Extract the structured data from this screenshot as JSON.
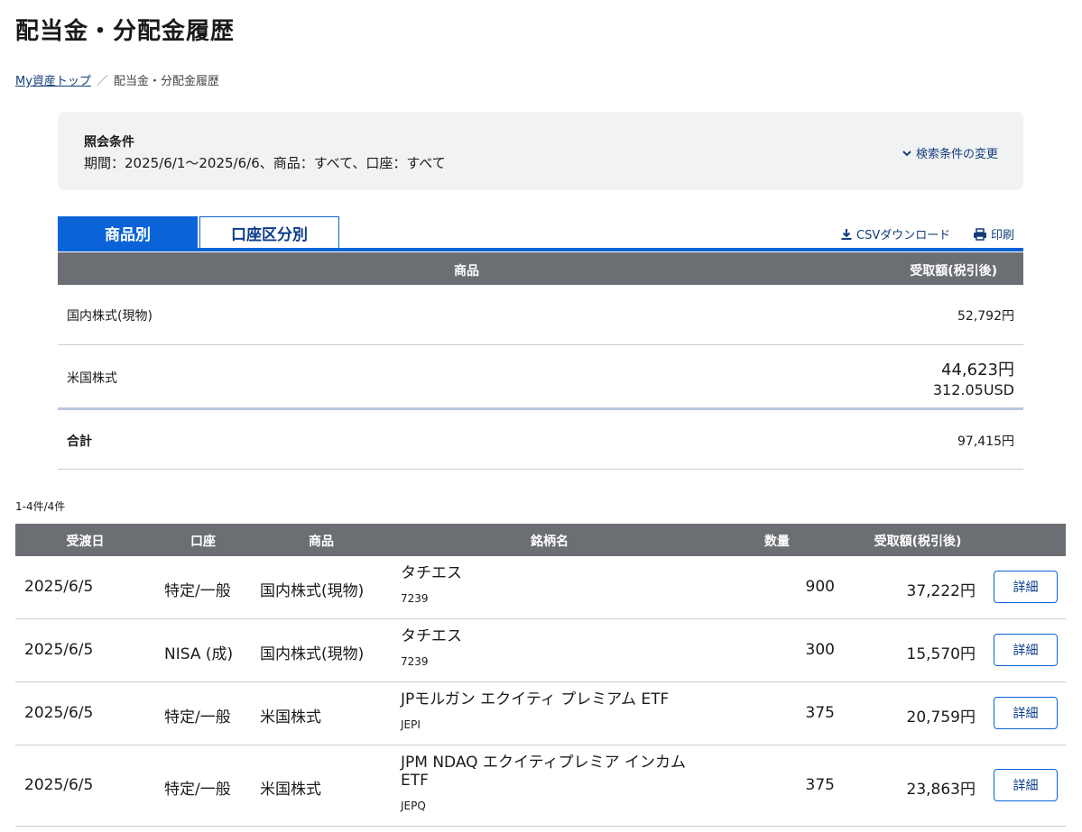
{
  "page_title": "配当金・分配金履歴",
  "breadcrumb": {
    "home": "My資産トップ",
    "separator": "／",
    "current": "配当金・分配金履歴"
  },
  "conditions": {
    "title": "照会条件",
    "text": "期間：2025/6/1〜2025/6/6、商品：すべて、口座：すべて",
    "change_label": "検索条件の変更"
  },
  "tabs": [
    {
      "label": "商品別",
      "active": true
    },
    {
      "label": "口座区分別",
      "active": false
    }
  ],
  "tools": {
    "csv_label": "CSVダウンロード",
    "print_label": "印刷"
  },
  "summary": {
    "headers": {
      "product": "商品",
      "amount": "受取額(税引後)"
    },
    "rows": [
      {
        "label": "国内株式(現物)",
        "amount": "52,792円"
      },
      {
        "label": "米国株式",
        "amount": "44,623円",
        "amount_usd": "312.05USD"
      }
    ],
    "total": {
      "label": "合計",
      "amount": "97,415円"
    }
  },
  "count_text": "1-4件/4件",
  "detail": {
    "headers": {
      "date": "受渡日",
      "account": "口座",
      "product": "商品",
      "name": "銘柄名",
      "qty": "数量",
      "amount": "受取額(税引後)"
    },
    "button_label": "詳細",
    "rows": [
      {
        "date": "2025/6/5",
        "account": "特定/一般",
        "product": "国内株式(現物)",
        "name": "タチエス",
        "code": "7239",
        "qty": "900",
        "amount": "37,222円"
      },
      {
        "date": "2025/6/5",
        "account": "NISA (成)",
        "product": "国内株式(現物)",
        "name": "タチエス",
        "code": "7239",
        "qty": "300",
        "amount": "15,570円"
      },
      {
        "date": "2025/6/5",
        "account": "特定/一般",
        "product": "米国株式",
        "name": "JPモルガン エクイティ プレミアム ETF",
        "code": "JEPI",
        "qty": "375",
        "amount": "20,759円"
      },
      {
        "date": "2025/6/5",
        "account": "特定/一般",
        "product": "米国株式",
        "name": "JPM NDAQ エクイティプレミア インカム ETF",
        "code": "JEPQ",
        "qty": "375",
        "amount": "23,863円"
      }
    ]
  },
  "colors": {
    "accent": "#0a64d7",
    "link": "#123d7a",
    "header_bg": "#6b6e73",
    "panel_bg": "#f1f2f4"
  }
}
